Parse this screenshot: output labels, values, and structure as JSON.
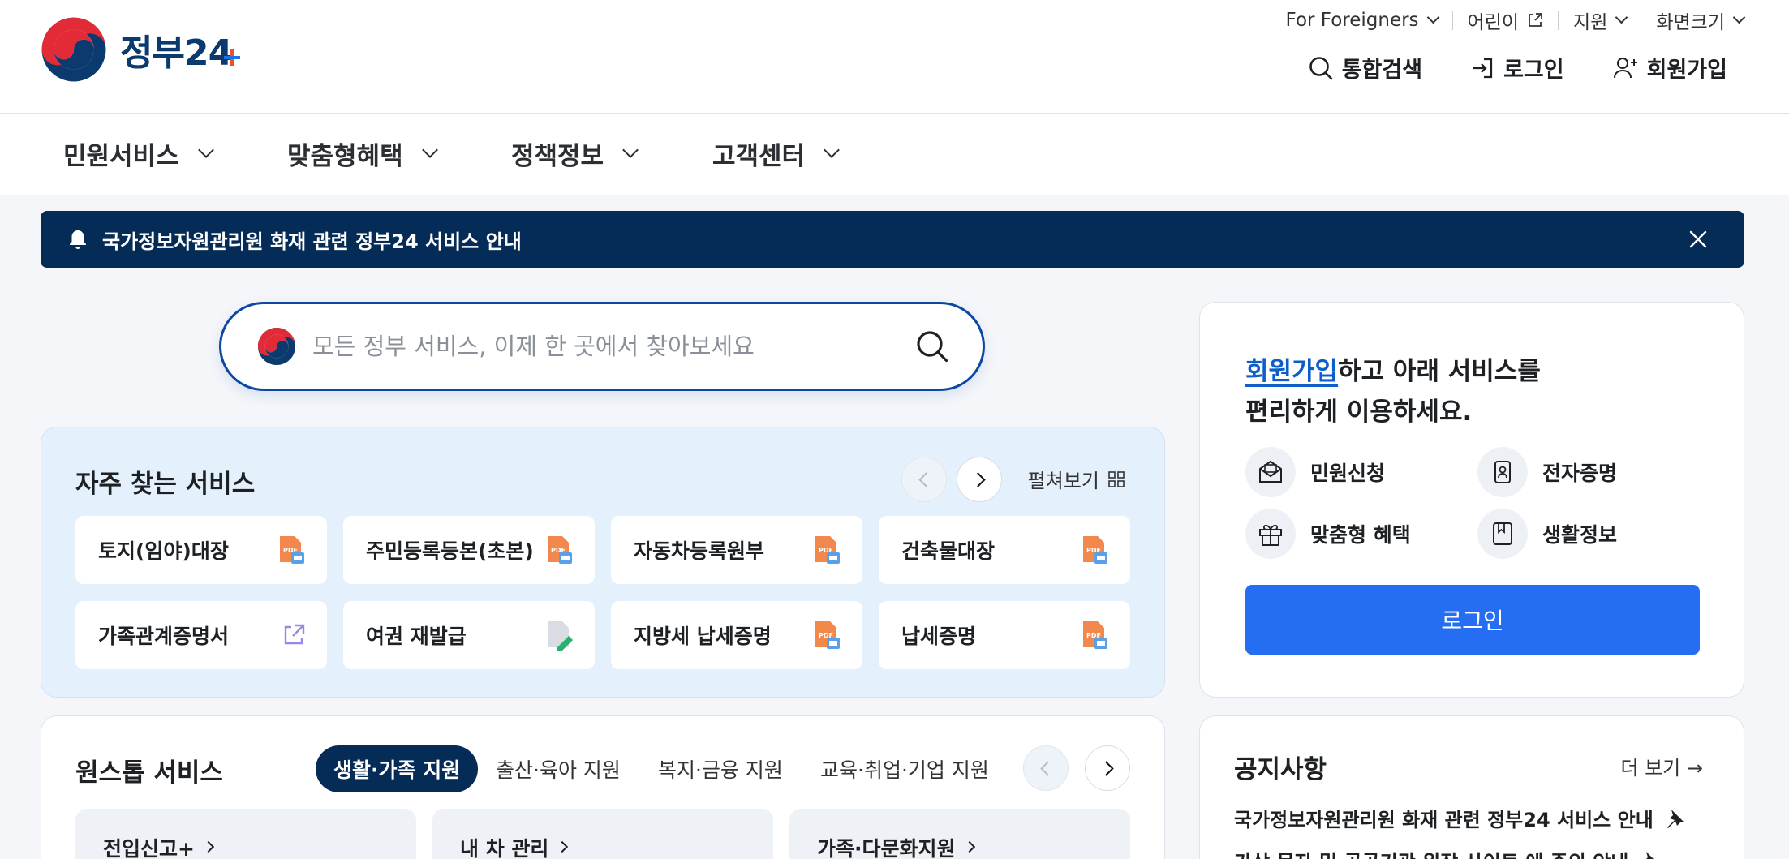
{
  "header": {
    "logo_text": "정부24",
    "util": {
      "foreigners": "For Foreigners",
      "kids": "어린이",
      "support": "지원",
      "font_size": "화면크기"
    },
    "auth": {
      "search": "통합검색",
      "login": "로그인",
      "signup": "회원가입"
    }
  },
  "nav": {
    "items": [
      "민원서비스",
      "맞춤형혜택",
      "정책정보",
      "고객센터"
    ]
  },
  "banner": {
    "text": "국가정보자원관리원 화재 관련 정부24 서비스 안내"
  },
  "search": {
    "placeholder": "모든 정부 서비스, 이제 한 곳에서 찾아보세요"
  },
  "frequent": {
    "title": "자주 찾는 서비스",
    "expand_label": "펼쳐보기",
    "services": [
      {
        "label": "토지(임야)대장",
        "icon": "pdf-icon"
      },
      {
        "label": "주민등록등본(초본)",
        "icon": "pdf-icon"
      },
      {
        "label": "자동차등록원부",
        "icon": "pdf-icon"
      },
      {
        "label": "건축물대장",
        "icon": "pdf-icon"
      },
      {
        "label": "가족관계증명서",
        "icon": "external-link-icon"
      },
      {
        "label": "여권 재발급",
        "icon": "edit-doc-icon"
      },
      {
        "label": "지방세 납세증명",
        "icon": "pdf-icon"
      },
      {
        "label": "납세증명",
        "icon": "pdf-icon"
      }
    ]
  },
  "member": {
    "signup_link": "회원가입",
    "head_rest": "하고 아래 서비스를",
    "head_line2": "편리하게 이용하세요.",
    "items": [
      "민원신청",
      "전자증명",
      "맞춤형 혜택",
      "생활정보"
    ],
    "login_button": "로그인"
  },
  "onestop": {
    "title": "원스톱 서비스",
    "tabs": [
      "생활·가족 지원",
      "출산·육아 지원",
      "복지·금융 지원",
      "교육·취업·기업 지원"
    ],
    "active_tab": "생활·가족 지원",
    "cards": [
      "전입신고+",
      "내 차 관리",
      "가족·다문화지원"
    ]
  },
  "notice": {
    "title": "공지사항",
    "more": "더 보기 →",
    "items": [
      "국가정보자원관리원 화재 관련 정부24 서비스 안내",
      "가상 문자 및 공공기관 위장 사이트 에 주의 안내"
    ]
  },
  "colors": {
    "brand_navy": "#052b57",
    "primary_blue": "#256ef4",
    "link_blue": "#0d5ec9",
    "freq_bg": "#e4f0fc"
  }
}
